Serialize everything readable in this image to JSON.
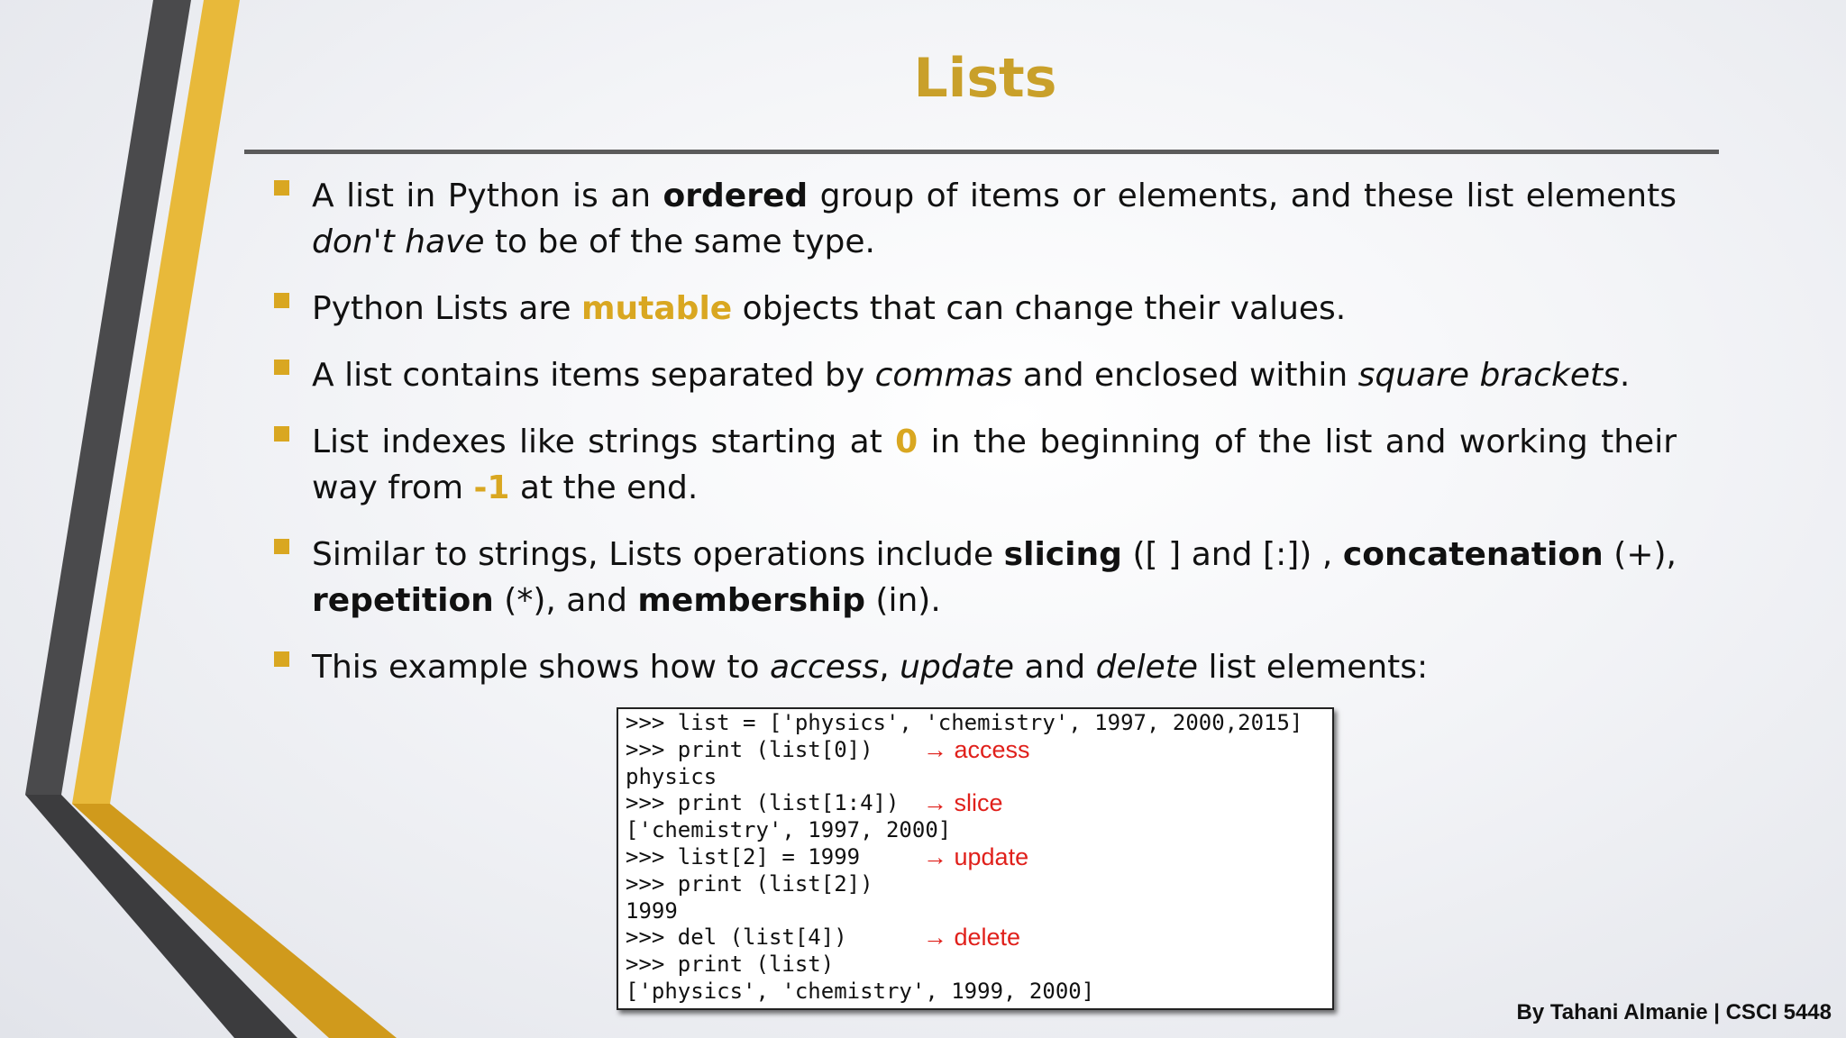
{
  "slide": {
    "title": "Lists",
    "footer": "By Tahani Almanie | CSCI 5448",
    "accent_color": "#d9a721",
    "title_color": "#c9a02a",
    "bullets": [
      {
        "segments": [
          {
            "text": "A list in Python is an ",
            "style": "normal"
          },
          {
            "text": "ordered",
            "style": "bold"
          },
          {
            "text": " group of items or elements, and these list elements ",
            "style": "normal"
          },
          {
            "text": "don't have",
            "style": "italic"
          },
          {
            "text": " to be of the same type.",
            "style": "normal"
          }
        ]
      },
      {
        "segments": [
          {
            "text": "Python Lists are ",
            "style": "normal"
          },
          {
            "text": "mutable",
            "style": "gold"
          },
          {
            "text": " objects that can change their values.",
            "style": "normal"
          }
        ]
      },
      {
        "segments": [
          {
            "text": "A list contains items separated by ",
            "style": "normal"
          },
          {
            "text": "commas",
            "style": "italic"
          },
          {
            "text": " and enclosed within ",
            "style": "normal"
          },
          {
            "text": "square brackets",
            "style": "italic"
          },
          {
            "text": ".",
            "style": "normal"
          }
        ]
      },
      {
        "segments": [
          {
            "text": "List indexes like strings starting at ",
            "style": "normal"
          },
          {
            "text": "0",
            "style": "gold"
          },
          {
            "text": " in the beginning of the list and working their way from ",
            "style": "normal"
          },
          {
            "text": "-1",
            "style": "gold"
          },
          {
            "text": " at the end.",
            "style": "normal"
          }
        ]
      },
      {
        "segments": [
          {
            "text": "Similar to strings, Lists operations include ",
            "style": "normal"
          },
          {
            "text": "slicing",
            "style": "bold"
          },
          {
            "text": " ([ ] and [:]) , ",
            "style": "normal"
          },
          {
            "text": "concatenation",
            "style": "bold"
          },
          {
            "text": " (+), ",
            "style": "normal"
          },
          {
            "text": "repetition",
            "style": "bold"
          },
          {
            "text": " (*), and ",
            "style": "normal"
          },
          {
            "text": "membership",
            "style": "bold"
          },
          {
            "text": " (in).",
            "style": "normal"
          }
        ]
      },
      {
        "segments": [
          {
            "text": "This example shows how to ",
            "style": "normal"
          },
          {
            "text": "access",
            "style": "italic"
          },
          {
            "text": ", ",
            "style": "normal"
          },
          {
            "text": "update",
            "style": "italic"
          },
          {
            "text": " and ",
            "style": "normal"
          },
          {
            "text": "delete",
            "style": "italic"
          },
          {
            "text": " list elements:",
            "style": "normal"
          }
        ]
      }
    ],
    "code_lines": [
      {
        "code": ">>> list = ['physics', 'chemistry', 1997, 2000,2015]",
        "annotation": ""
      },
      {
        "code": ">>> print (list[0])",
        "annotation": "→ access"
      },
      {
        "code": "physics",
        "annotation": ""
      },
      {
        "code": ">>> print (list[1:4])",
        "annotation": "→ slice"
      },
      {
        "code": "['chemistry', 1997, 2000]",
        "annotation": ""
      },
      {
        "code": ">>> list[2] = 1999",
        "annotation": "→ update"
      },
      {
        "code": ">>> print (list[2])",
        "annotation": ""
      },
      {
        "code": "1999",
        "annotation": ""
      },
      {
        "code": ">>> del (list[4])",
        "annotation": "→ delete"
      },
      {
        "code": ">>> print (list)",
        "annotation": ""
      },
      {
        "code": "['physics', 'chemistry', 1999, 2000]",
        "annotation": ""
      }
    ]
  }
}
